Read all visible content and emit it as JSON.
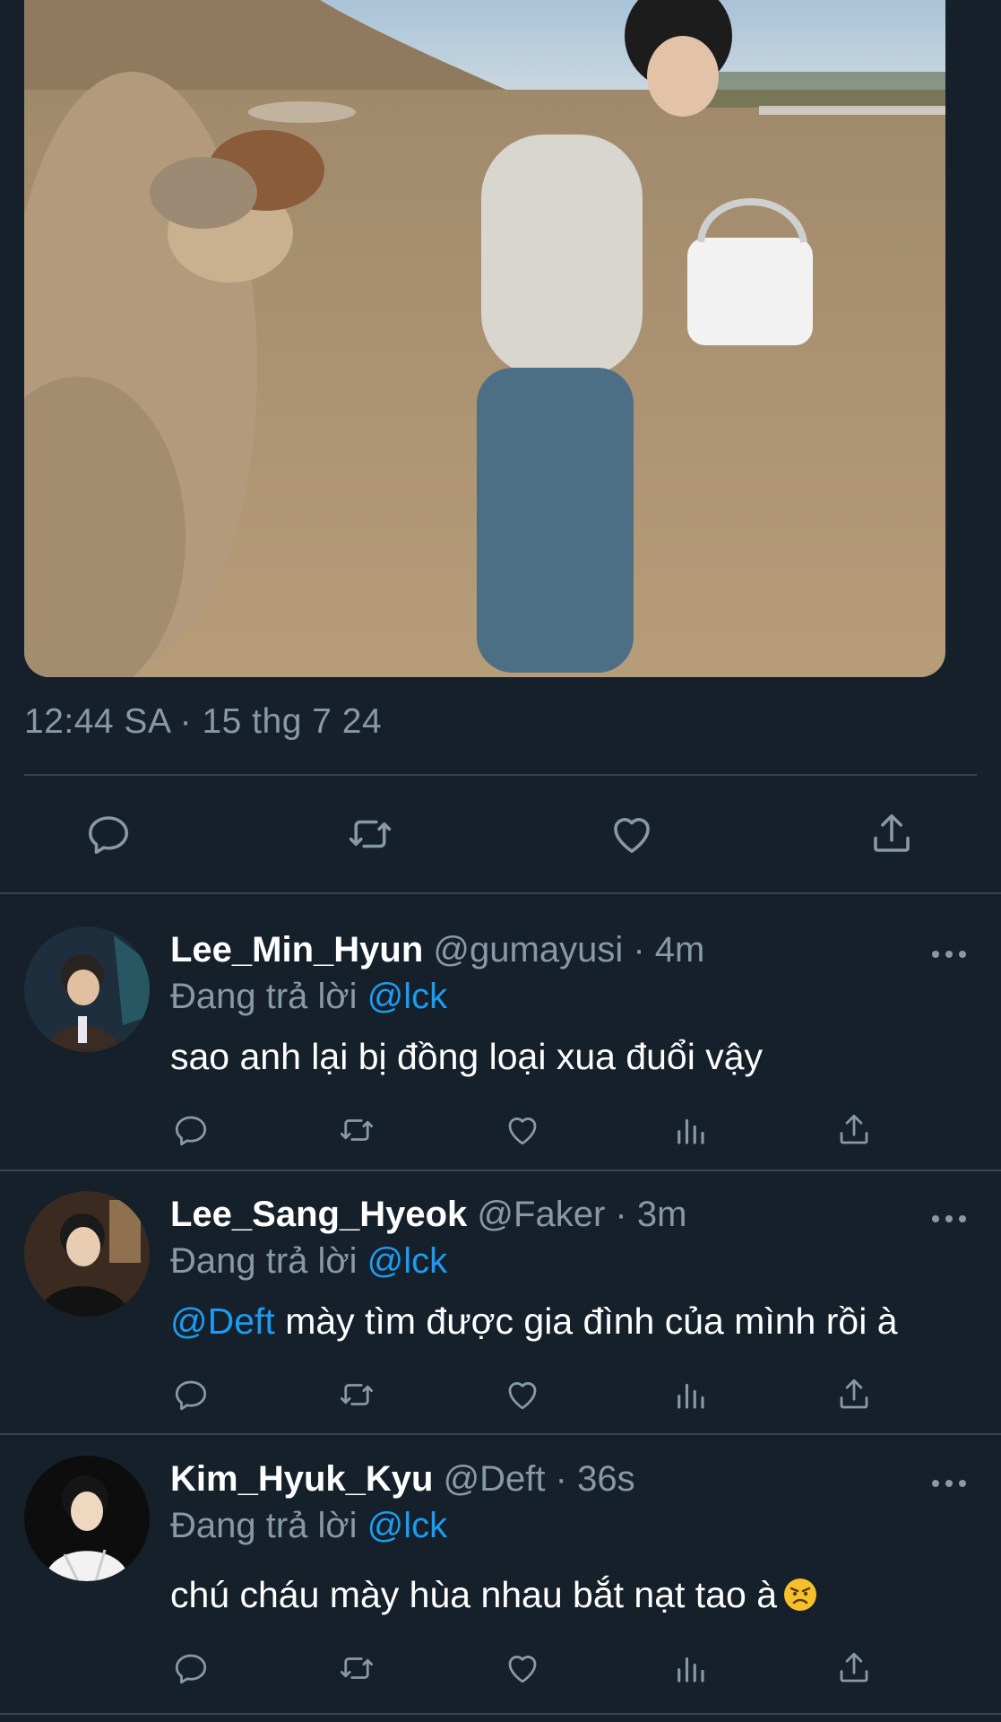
{
  "tweet": {
    "timestamp": "12:44 SA · 15 thg 7 24"
  },
  "replies": [
    {
      "display_name": "Lee_Min_Hyun",
      "handle": "@gumayusi",
      "separator": "·",
      "time": "4m",
      "replying_label": "Đang trả lời",
      "replying_to": "@lck",
      "text": "sao anh lại bị đồng loại xua đuổi vậy"
    },
    {
      "display_name": "Lee_Sang_Hyeok",
      "handle": "@Faker",
      "separator": "·",
      "time": "3m",
      "replying_label": "Đang trả lời",
      "replying_to": "@lck",
      "text_mention": "@Deft",
      "text": " mày tìm được gia đình của mình rồi à"
    },
    {
      "display_name": "Kim_Hyuk_Kyu",
      "handle": "@Deft",
      "separator": "·",
      "time": "36s",
      "replying_label": "Đang trả lời",
      "replying_to": "@lck",
      "text": "chú cháu mày hùa nhau bắt nạt tao à",
      "emoji": "angry-face-emoji"
    }
  ],
  "icons": {
    "reply": "reply-icon",
    "retweet": "retweet-icon",
    "like": "heart-icon",
    "share": "share-icon",
    "analytics": "analytics-icon",
    "more": "more-icon"
  },
  "colors": {
    "background": "#15202b",
    "secondary_text": "#8899a6",
    "accent": "#1d9bf0",
    "divider": "#38444d"
  }
}
